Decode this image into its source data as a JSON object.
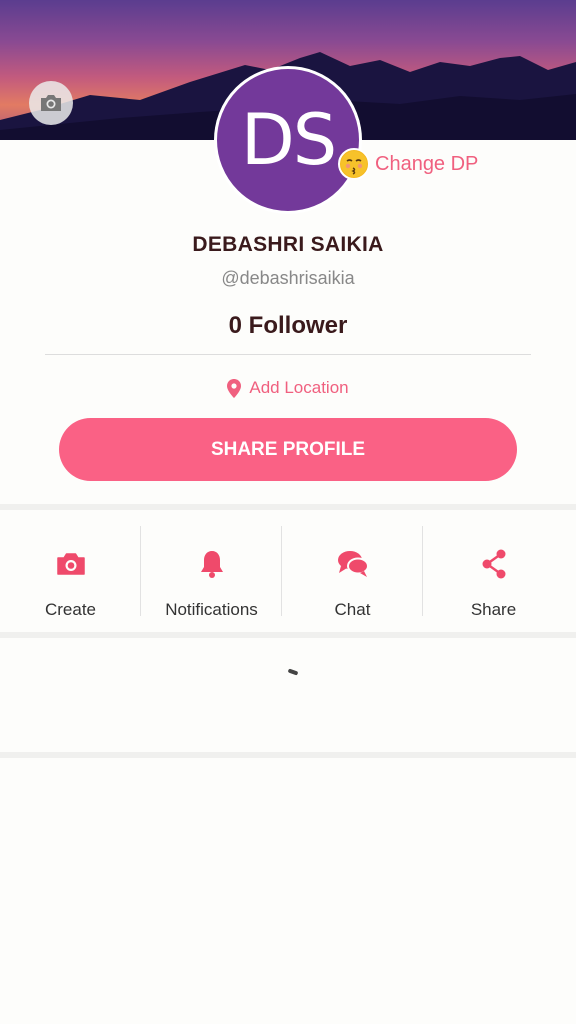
{
  "profile": {
    "initials": "DS",
    "change_dp_label": "Change DP",
    "name": "DEBASHRI SAIKIA",
    "handle": "@debashrisaikia",
    "followers": "0 Follower",
    "location_label": "Add Location",
    "share_button": "SHARE PROFILE"
  },
  "actions": [
    {
      "label": "Create",
      "icon": "camera-icon"
    },
    {
      "label": "Notifications",
      "icon": "bell-icon"
    },
    {
      "label": "Chat",
      "icon": "chat-icon"
    },
    {
      "label": "Share",
      "icon": "share-icon"
    }
  ],
  "colors": {
    "accent": "#fa6185",
    "accent_text": "#f0607f",
    "avatar_bg": "#73399a",
    "name_text": "#3a1a1c"
  }
}
